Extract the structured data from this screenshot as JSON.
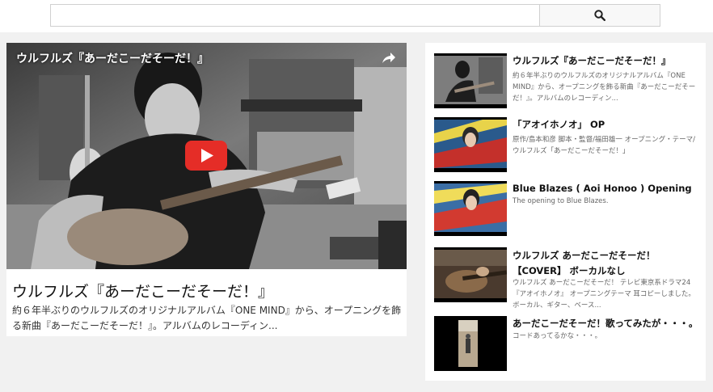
{
  "search": {
    "placeholder": "",
    "value": "",
    "button_icon": "search-icon"
  },
  "main_video": {
    "player_title": "ウルフルズ『あーだこーだそーだ！』",
    "title": "ウルフルズ『あーだこーだそーだ！』",
    "description": "約６年半ぶりのウルフルズのオリジナルアルバム『ONE MIND』から、オープニングを飾る新曲『あーだこーだそーだ！』。アルバムのレコーディン...",
    "share_icon": "share-icon",
    "play_icon": "youtube-play-icon"
  },
  "related": [
    {
      "title": "ウルフルズ『あーだこーだそーだ！』",
      "description": "約６年半ぶりのウルフルズのオリジナルアルバム『ONE MIND』から、オープニングを飾る新曲『あーだこーだそーだ！』。アルバムのレコーディン..."
    },
    {
      "title": "「アオイホノオ」 OP",
      "description": "原作/島本和彦 脚本・監督/福田雄一 オープニング・テーマ/ウルフルズ「あーだこーだそーだ！」"
    },
    {
      "title": "Blue Blazes ( Aoi Honoo ) Opening",
      "description": "The opening to Blue Blazes."
    },
    {
      "title": "ウルフルズ あーだこーだそーだ！【COVER】 ボーカルなし",
      "description": "ウルフルズ あーだこーだそーだ！ テレビ東京系ドラマ24『アオイホノオ』 オープニングテーマ 耳コピーしました。 ボーカル、ギター、ベース..."
    },
    {
      "title": "あーだこーだそーだ！歌ってみたが・・・。",
      "description": "コードあってるかな・・・。"
    }
  ]
}
